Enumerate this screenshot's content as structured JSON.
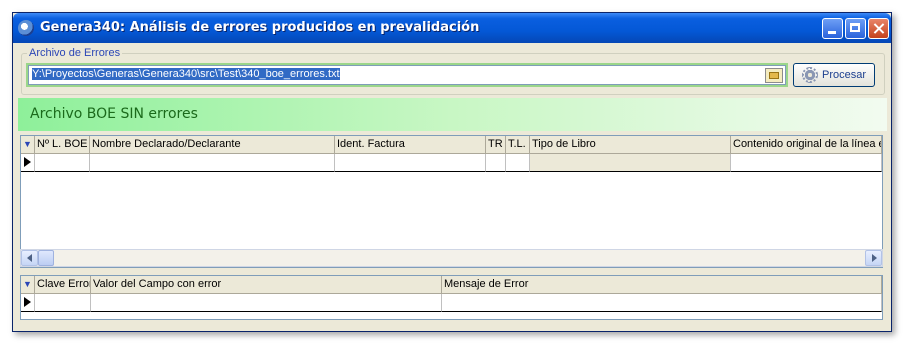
{
  "window": {
    "title": "Genera340: Análisis de errores producidos en prevalidación"
  },
  "file_section": {
    "group_label": "Archivo de Errores",
    "path_value": "Y:\\Proyectos\\Generas\\Genera340\\src\\Test\\340_boe_errores.txt",
    "process_label": "Procesar"
  },
  "status_banner": {
    "text": "Archivo BOE SIN errores",
    "color": "#1b6a1b"
  },
  "records_grid": {
    "columns": [
      "Nº L. BOE",
      "Nombre Declarado/Declarante",
      "Ident. Factura",
      "TR",
      "T.L.",
      "Tipo de Libro",
      "Contenido original de la línea en"
    ]
  },
  "errors_grid": {
    "columns": [
      "Clave Error",
      "Valor del Campo con error",
      "Mensaje de Error"
    ]
  },
  "icons": {
    "app": "app-logo-icon",
    "folder": "folder-open-icon",
    "process": "gear-icon"
  }
}
